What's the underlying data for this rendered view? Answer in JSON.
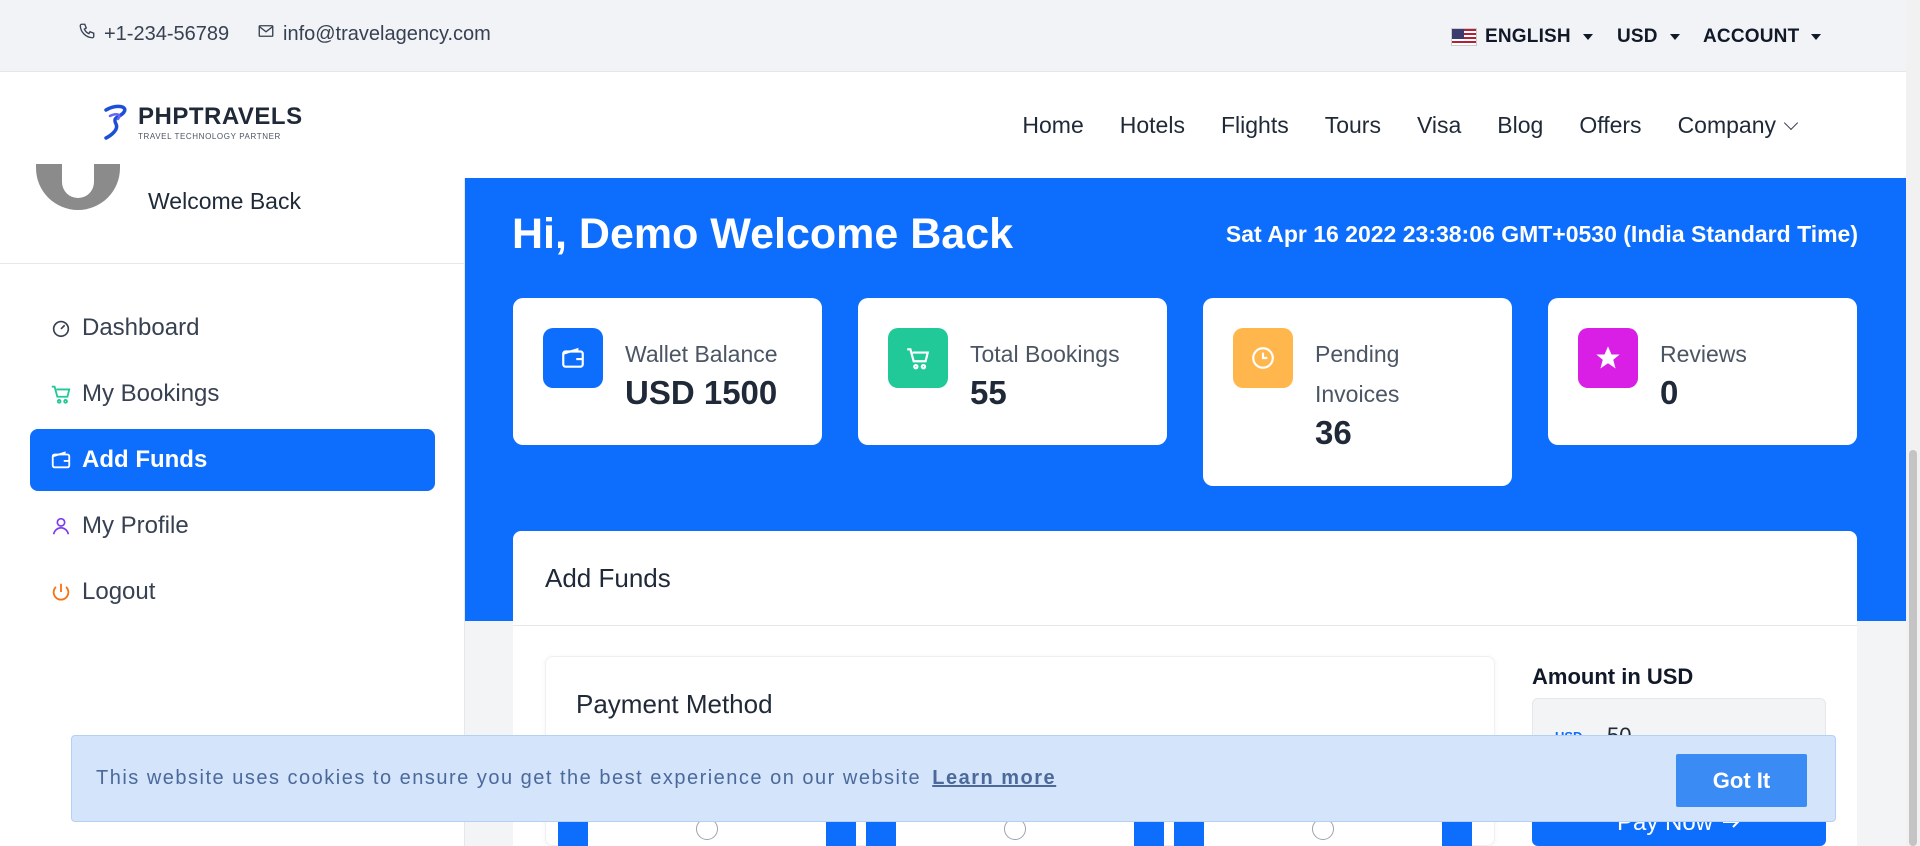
{
  "topbar": {
    "phone": "+1-234-56789",
    "email": "info@travelagency.com",
    "language": "ENGLISH",
    "currency": "USD",
    "account": "ACCOUNT"
  },
  "header": {
    "logo_title": "PHPTRAVELS",
    "logo_subtitle": "TRAVEL TECHNOLOGY PARTNER",
    "nav": [
      "Home",
      "Hotels",
      "Flights",
      "Tours",
      "Visa",
      "Blog",
      "Offers",
      "Company"
    ]
  },
  "sidebar": {
    "welcome": "Welcome Back",
    "items": [
      {
        "label": "Dashboard",
        "icon": "gauge-icon"
      },
      {
        "label": "My Bookings",
        "icon": "cart-icon"
      },
      {
        "label": "Add Funds",
        "icon": "wallet-icon",
        "active": true
      },
      {
        "label": "My Profile",
        "icon": "user-icon"
      },
      {
        "label": "Logout",
        "icon": "power-icon"
      }
    ]
  },
  "main": {
    "greeting": "Hi, Demo Welcome Back",
    "datetime": "Sat Apr 16 2022 23:38:06 GMT+0530 (India Standard Time)",
    "stats": [
      {
        "label": "Wallet Balance",
        "value": "USD 1500",
        "color": "#0d6efd",
        "icon": "wallet-icon"
      },
      {
        "label": "Total Bookings",
        "value": "55",
        "color": "#20c997",
        "icon": "cart-icon"
      },
      {
        "label": "Pending Invoices",
        "value": "36",
        "color": "#ffb74d",
        "icon": "clock-icon"
      },
      {
        "label": "Reviews",
        "value": "0",
        "color": "#d91ee6",
        "icon": "star-icon"
      }
    ],
    "panel_title": "Add Funds",
    "payment_method_title": "Payment Method",
    "amount_label": "Amount in USD",
    "amount_currency": "USD",
    "amount_value": "50",
    "pay_now": "Pay Now"
  },
  "cookie": {
    "text": "This website uses cookies to ensure you get the best experience on our website",
    "link": "Learn more",
    "button": "Got It"
  },
  "colors": {
    "primary": "#0d6efd",
    "cookie_bg": "#d4e4fb"
  }
}
